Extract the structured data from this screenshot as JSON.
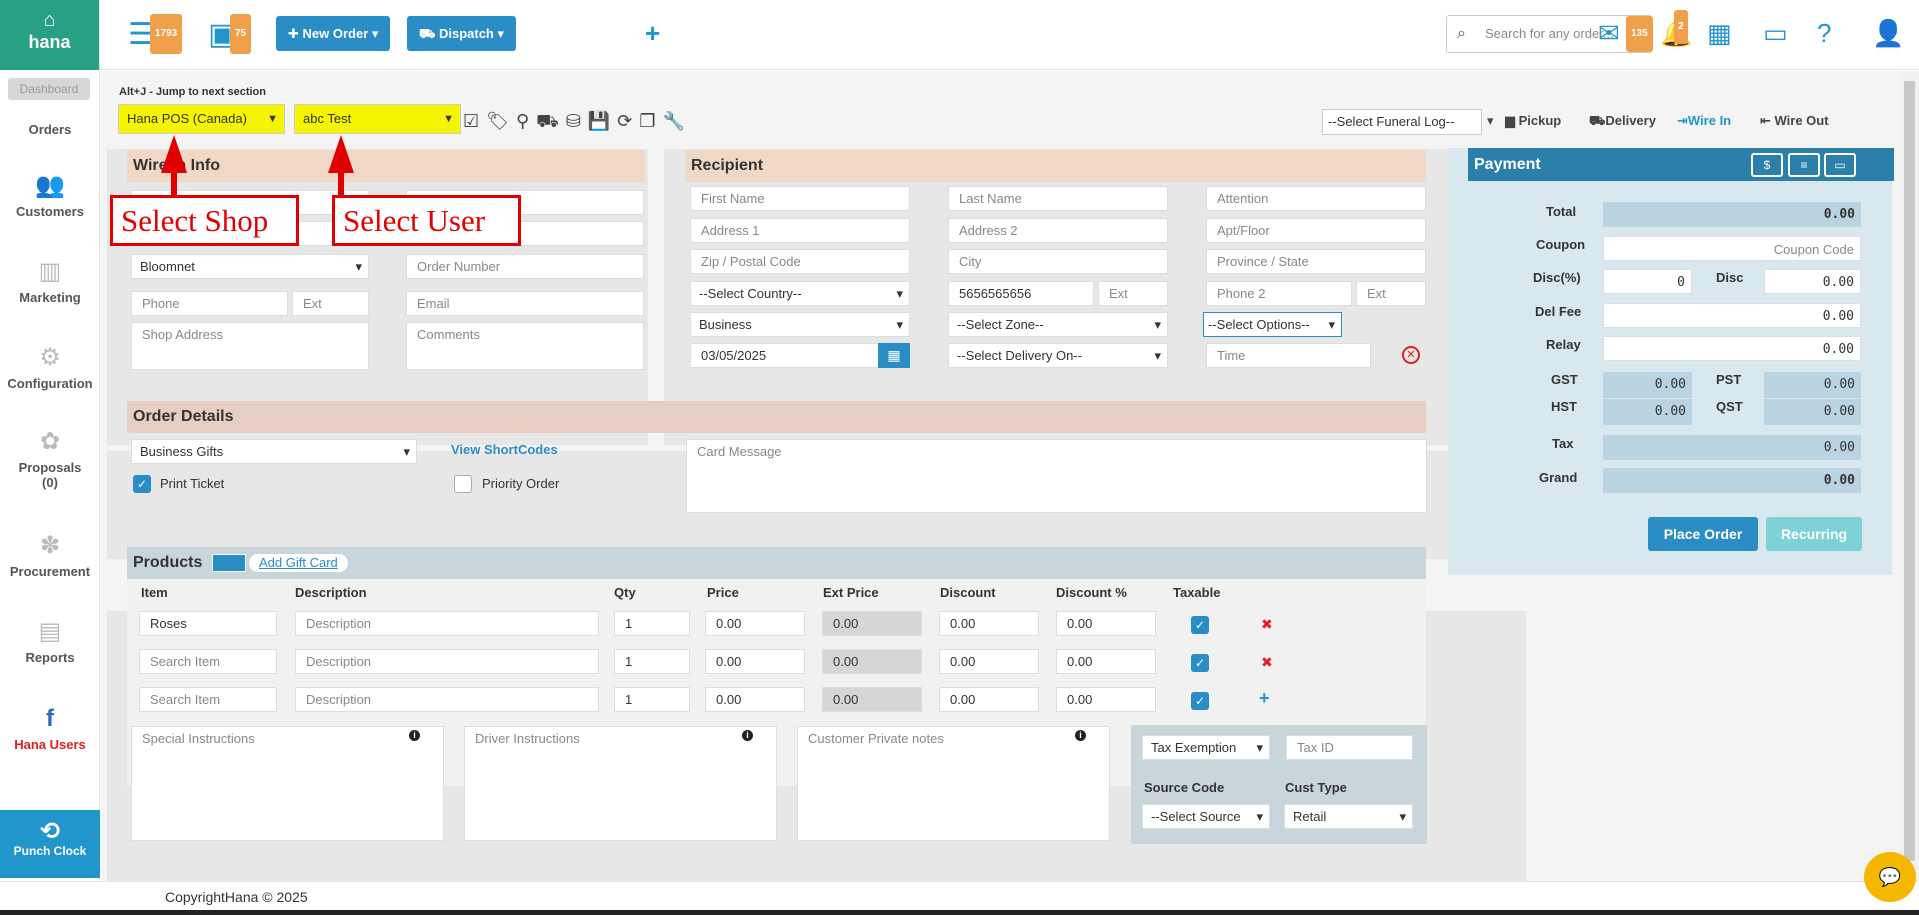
{
  "brand": {
    "name": "hana"
  },
  "sidebar": {
    "tooltip": "Dashboard",
    "items": [
      {
        "label": "Orders"
      },
      {
        "label": "Customers"
      },
      {
        "label": "Marketing"
      },
      {
        "label": "Configuration"
      },
      {
        "label": "Proposals"
      },
      {
        "label": "(0)"
      },
      {
        "label": "Procurement"
      },
      {
        "label": "Reports"
      },
      {
        "label": "Hana Users"
      }
    ],
    "punch_clock": "Punch Clock"
  },
  "topbar": {
    "badge_orders": "1793",
    "badge_tablets": "75",
    "new_order": "New Order",
    "dispatch": "Dispatch",
    "search_placeholder": "Search for any order...",
    "badge_mail": "135",
    "badge_bell": "2"
  },
  "toolbar": {
    "hint": "Alt+J - Jump to next section",
    "shop_select": "Hana POS (Canada)",
    "user_select": "abc Test",
    "funeral_log": "--Select Funeral Log--",
    "pickup": "Pickup",
    "delivery": "Delivery",
    "wire_in": "Wire In",
    "wire_out": "Wire Out"
  },
  "annotations": {
    "select_shop": "Select Shop",
    "select_user": "Select User"
  },
  "wire_in": {
    "title": "Wire In Info",
    "wire_service": "Bloomnet",
    "order_number": "Order Number",
    "phone": "Phone",
    "ext": "Ext",
    "email": "Email",
    "shop_address": "Shop Address",
    "comments": "Comments"
  },
  "recipient": {
    "title": "Recipient",
    "first_name": "First Name",
    "last_name": "Last Name",
    "attention": "Attention",
    "address1": "Address 1",
    "address2": "Address 2",
    "apt": "Apt/Floor",
    "zip": "Zip / Postal Code",
    "city": "City",
    "province": "Province / State",
    "country": "--Select Country--",
    "phone": "5656565656",
    "ext": "Ext",
    "phone2": "Phone 2",
    "ext2": "Ext",
    "location_type": "Business",
    "zone": "--Select Zone--",
    "options": "--Select Options--",
    "date": "03/05/2025",
    "delivery_on": "--Select Delivery On--",
    "time": "Time"
  },
  "order_details": {
    "title": "Order Details",
    "occasion": "Business Gifts",
    "view_shortcodes": "View ShortCodes",
    "card_message": "Card Message",
    "print_ticket": "Print Ticket",
    "priority_order": "Priority Order"
  },
  "products": {
    "title": "Products",
    "add_gift_card": "Add Gift Card",
    "columns": [
      "Item",
      "Description",
      "Qty",
      "Price",
      "Ext Price",
      "Discount",
      "Discount %",
      "Taxable"
    ],
    "rows": [
      {
        "item": "Roses",
        "desc": "Description",
        "qty": "1",
        "price": "0.00",
        "ext": "0.00",
        "disc": "0.00",
        "discp": "0.00"
      },
      {
        "item": "Search Item",
        "desc": "Description",
        "qty": "1",
        "price": "0.00",
        "ext": "0.00",
        "disc": "0.00",
        "discp": "0.00"
      },
      {
        "item": "Search Item",
        "desc": "Description",
        "qty": "1",
        "price": "0.00",
        "ext": "0.00",
        "disc": "0.00",
        "discp": "0.00"
      }
    ],
    "special_instructions": "Special Instructions",
    "driver_instructions": "Driver Instructions",
    "private_notes": "Customer Private notes",
    "tax_exemption": "Tax Exemption",
    "tax_id": "Tax ID",
    "source_code_label": "Source Code",
    "cust_type_label": "Cust Type",
    "source_code": "--Select Source",
    "cust_type": "Retail"
  },
  "payment": {
    "title": "Payment",
    "total_label": "Total",
    "total": "0.00",
    "coupon_label": "Coupon",
    "coupon_placeholder": "Coupon Code",
    "discp_label": "Disc(%)",
    "discp": "0",
    "disc_label": "Disc",
    "disc": "0.00",
    "delfee_label": "Del Fee",
    "delfee": "0.00",
    "relay_label": "Relay",
    "relay": "0.00",
    "gst_label": "GST",
    "gst": "0.00",
    "pst_label": "PST",
    "pst": "0.00",
    "hst_label": "HST",
    "hst": "0.00",
    "qst_label": "QST",
    "qst": "0.00",
    "tax_label": "Tax",
    "tax": "0.00",
    "grand_label": "Grand",
    "grand": "0.00",
    "place_order": "Place Order",
    "recurring": "Recurring"
  },
  "footer": {
    "text": "CopyrightHana © 2025"
  }
}
